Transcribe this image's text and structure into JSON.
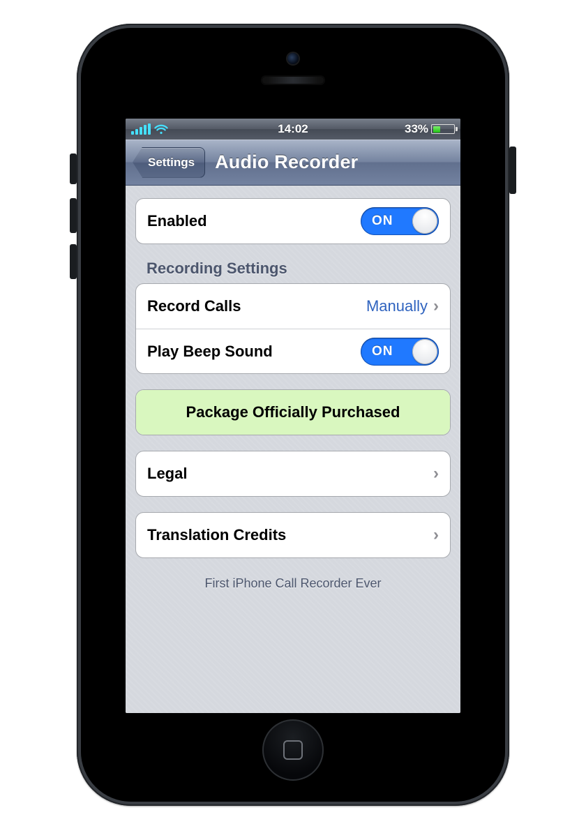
{
  "status": {
    "time": "14:02",
    "battery_pct": "33%"
  },
  "nav": {
    "back": "Settings",
    "title": "Audio Recorder"
  },
  "groups": {
    "main": {
      "enabled_label": "Enabled",
      "enabled_toggle": "ON"
    },
    "recording": {
      "header": "Recording Settings",
      "record_calls_label": "Record Calls",
      "record_calls_value": "Manually",
      "play_beep_label": "Play Beep Sound",
      "play_beep_toggle": "ON"
    },
    "purchase": {
      "label": "Package Officially Purchased"
    },
    "legal": {
      "label": "Legal"
    },
    "credits": {
      "label": "Translation Credits"
    }
  },
  "footer": "First iPhone Call Recorder Ever"
}
